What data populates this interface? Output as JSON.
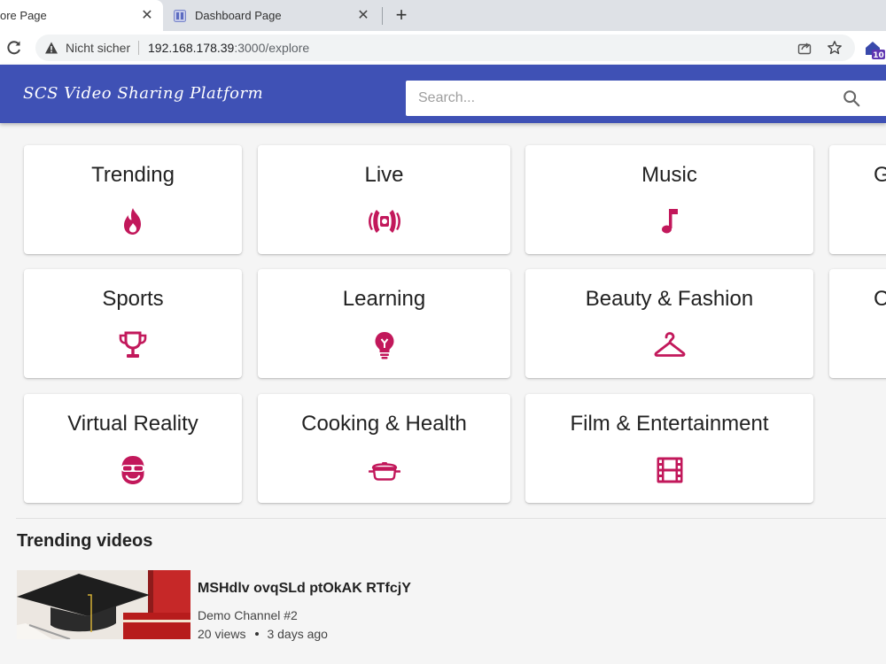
{
  "browser": {
    "tabs": [
      {
        "title": "ore Page",
        "active": true
      },
      {
        "title": "Dashboard Page",
        "active": false
      }
    ],
    "address": {
      "security_label": "Nicht sicher",
      "host": "192.168.178.39",
      "path": ":3000/explore"
    },
    "extension_badge": "10"
  },
  "app": {
    "logo": "SCS Video Sharing Platform",
    "search_placeholder": "Search..."
  },
  "categories": [
    {
      "label": "Trending",
      "icon": "flame-icon"
    },
    {
      "label": "Live",
      "icon": "broadcast-icon"
    },
    {
      "label": "Music",
      "icon": "music-note-icon"
    },
    {
      "label": "G",
      "icon": ""
    },
    {
      "label": "Sports",
      "icon": "trophy-icon"
    },
    {
      "label": "Learning",
      "icon": "lightbulb-icon"
    },
    {
      "label": "Beauty & Fashion",
      "icon": "hanger-icon"
    },
    {
      "label": "C",
      "icon": ""
    },
    {
      "label": "Virtual Reality",
      "icon": "vr-headset-icon"
    },
    {
      "label": "Cooking & Health",
      "icon": "cooking-pot-icon"
    },
    {
      "label": "Film & Entertainment",
      "icon": "film-icon"
    }
  ],
  "trending": {
    "title": "Trending videos",
    "videos": [
      {
        "title": "MSHdlv ovqSLd ptOkAK RTfcjY",
        "channel": "Demo Channel #2",
        "views": "20 views",
        "age": "3 days ago"
      }
    ]
  },
  "colors": {
    "primary": "#3f51b5",
    "accent": "#c2185b"
  }
}
